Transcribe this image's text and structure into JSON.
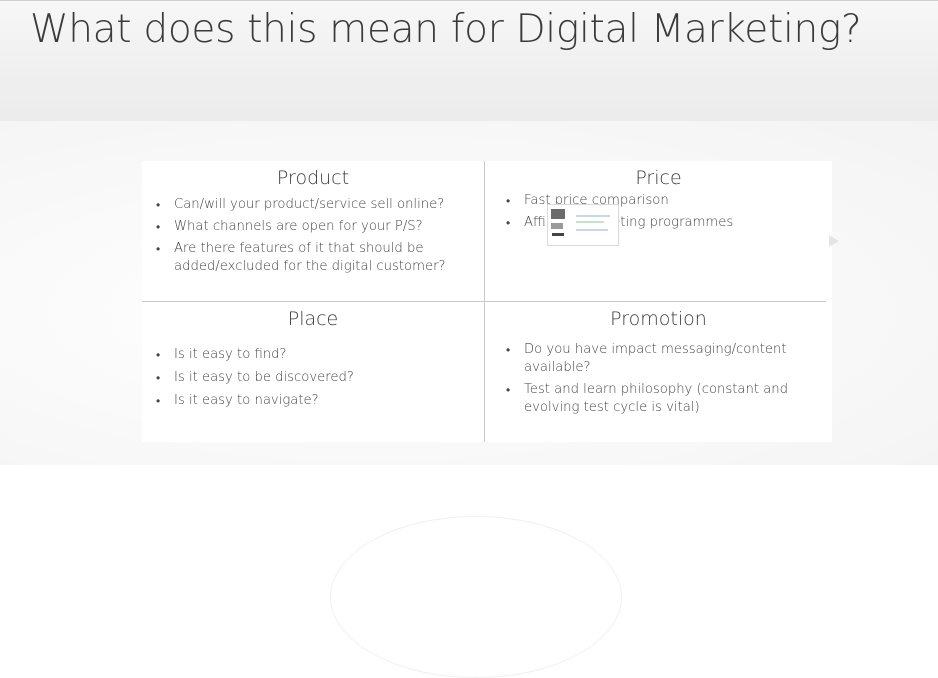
{
  "slide": {
    "title": "What does this mean for Digital Marketing?"
  },
  "quadrants": {
    "product": {
      "heading": "Product",
      "items": [
        "Can/will your product/service sell online?",
        "What channels are open for your P/S?",
        "Are there features of it that should be added/excluded for the digital customer?"
      ]
    },
    "price": {
      "heading": "Price",
      "items": [
        "Fast price comparison",
        "Affiliate marketing programmes"
      ]
    },
    "place": {
      "heading": "Place",
      "items": [
        "Is it easy to find?",
        "Is it easy to be discovered?",
        "Is it easy to navigate?"
      ]
    },
    "promotion": {
      "heading": "Promotion",
      "items": [
        "Do you have impact messaging/content available?",
        "Test and learn philosophy (constant and evolving test cycle is vital)"
      ]
    }
  },
  "icons": {
    "play": "play-icon",
    "thumbnail": "website-thumbnail"
  }
}
